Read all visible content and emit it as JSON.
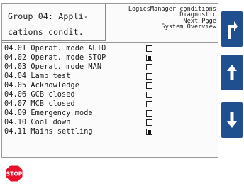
{
  "header": {
    "title_line1": "Group 04: Appli-",
    "title_line2": "cations condit.",
    "hints": [
      "LogicsManager conditions",
      "Diagnostic",
      "Next Page",
      "System Overview"
    ]
  },
  "items": [
    {
      "label": "04.01 Operat. mode AUTO",
      "checked": false
    },
    {
      "label": "04.02 Operat. mode STOP",
      "checked": true
    },
    {
      "label": "04.03 Operat. mode MAN",
      "checked": false
    },
    {
      "label": "04.04 Lamp test",
      "checked": false
    },
    {
      "label": "04.05 Acknowledge",
      "checked": false
    },
    {
      "label": "04.06 GCB closed",
      "checked": false
    },
    {
      "label": "04.07 MCB closed",
      "checked": false
    },
    {
      "label": "04.09 Emergency mode",
      "checked": false
    },
    {
      "label": "04.10 Cool down",
      "checked": false
    },
    {
      "label": "04.11 Mains settling",
      "checked": true
    }
  ],
  "buttons": {
    "return": {
      "icon": "return-arrow-icon"
    },
    "up": {
      "icon": "arrow-up-icon"
    },
    "down": {
      "icon": "arrow-down-icon"
    },
    "stop": {
      "label": "STOP",
      "icon": "stop-sign-icon",
      "color": "#e8112d"
    }
  },
  "colors": {
    "button": "#1f4f8e"
  }
}
